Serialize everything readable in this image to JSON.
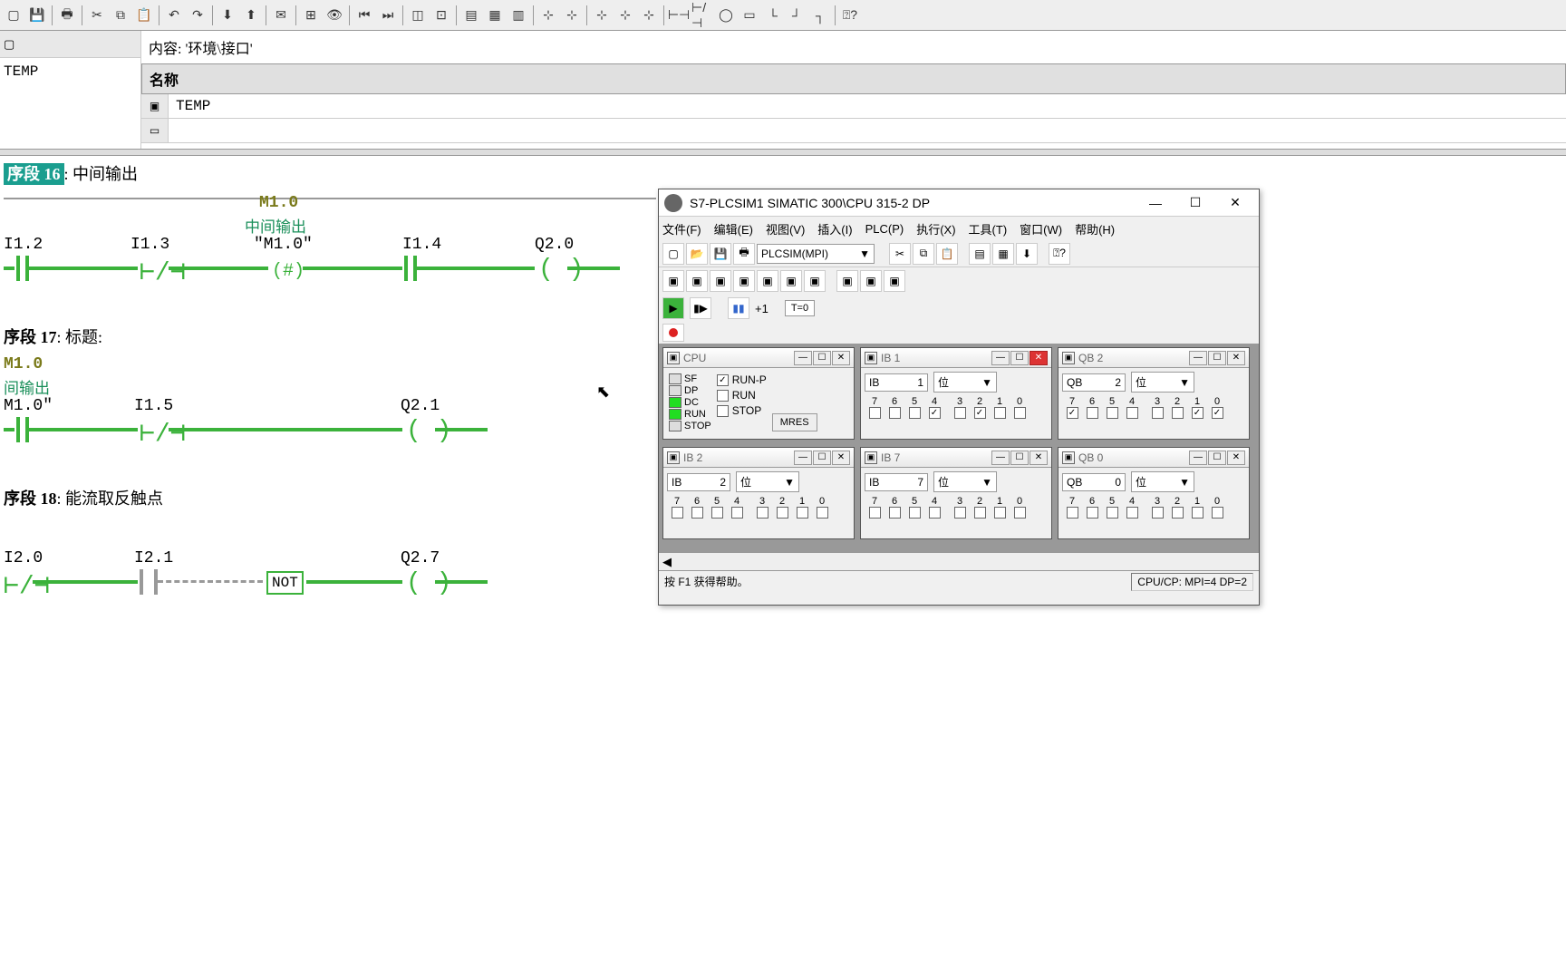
{
  "header": {
    "content_label": "内容: '环境\\接口'",
    "name_header": "名称",
    "temp_left": "TEMP",
    "temp_row": "TEMP"
  },
  "networks": {
    "n16": {
      "prefix": "序段",
      "num": "16",
      "title_suffix": ": 中间输出",
      "m10": "M1.0",
      "m10_comment": "中间输出",
      "i12": "I1.2",
      "i13": "I1.3",
      "m10q": "\"M1.0\"",
      "i14": "I1.4",
      "q20": "Q2.0",
      "hash": "(#)"
    },
    "n17": {
      "prefix": "序段",
      "num": "17",
      "title_suffix": ": 标题:",
      "m10": "M1.0",
      "m10_comment": "间输出",
      "m10q": "M1.0\"",
      "i15": "I1.5",
      "q21": "Q2.1"
    },
    "n18": {
      "prefix": "序段",
      "num": "18",
      "title_suffix": ": 能流取反触点",
      "i20": "I2.0",
      "i21": "I2.1",
      "q27": "Q2.7",
      "not": "NOT"
    }
  },
  "plcsim": {
    "title": "S7-PLCSIM1    SIMATIC 300\\CPU 315-2 DP",
    "menus": {
      "file": "文件(F)",
      "edit": "编辑(E)",
      "view": "视图(V)",
      "insert": "插入(I)",
      "plc": "PLC(P)",
      "exec": "执行(X)",
      "tools": "工具(T)",
      "window": "窗口(W)",
      "help": "帮助(H)"
    },
    "combo": "PLCSIM(MPI)",
    "plus1": "+1",
    "t0": "T=0",
    "cpu": {
      "title": "CPU",
      "sf": "SF",
      "dp": "DP",
      "dc": "DC",
      "run": "RUN",
      "stop": "STOP",
      "runp": "RUN-P",
      "run2": "RUN",
      "stop2": "STOP",
      "mres": "MRES"
    },
    "ib1": {
      "title": "IB      1",
      "field_l": "IB",
      "field_v": "1",
      "combo": "位",
      "bits": [
        "7",
        "6",
        "5",
        "4",
        "3",
        "2",
        "1",
        "0"
      ],
      "checked": [
        false,
        false,
        false,
        true,
        false,
        true,
        false,
        false
      ]
    },
    "qb2": {
      "title": "QB     2",
      "field_l": "QB",
      "field_v": "2",
      "combo": "位",
      "bits": [
        "7",
        "6",
        "5",
        "4",
        "3",
        "2",
        "1",
        "0"
      ],
      "checked": [
        true,
        false,
        false,
        false,
        false,
        false,
        true,
        true
      ]
    },
    "ib2": {
      "title": "IB      2",
      "field_l": "IB",
      "field_v": "2",
      "combo": "位",
      "bits": [
        "7",
        "6",
        "5",
        "4",
        "3",
        "2",
        "1",
        "0"
      ],
      "checked": [
        false,
        false,
        false,
        false,
        false,
        false,
        false,
        false
      ]
    },
    "ib7": {
      "title": "IB      7",
      "field_l": "IB",
      "field_v": "7",
      "combo": "位",
      "bits": [
        "7",
        "6",
        "5",
        "4",
        "3",
        "2",
        "1",
        "0"
      ],
      "checked": [
        false,
        false,
        false,
        false,
        false,
        false,
        false,
        false
      ]
    },
    "qb0": {
      "title": "QB     0",
      "field_l": "QB",
      "field_v": "0",
      "combo": "位",
      "bits": [
        "7",
        "6",
        "5",
        "4",
        "3",
        "2",
        "1",
        "0"
      ],
      "checked": [
        false,
        false,
        false,
        false,
        false,
        false,
        false,
        false
      ]
    },
    "status_help": "按 F1 获得帮助。",
    "status_cpu": "CPU/CP:  MPI=4 DP=2"
  }
}
